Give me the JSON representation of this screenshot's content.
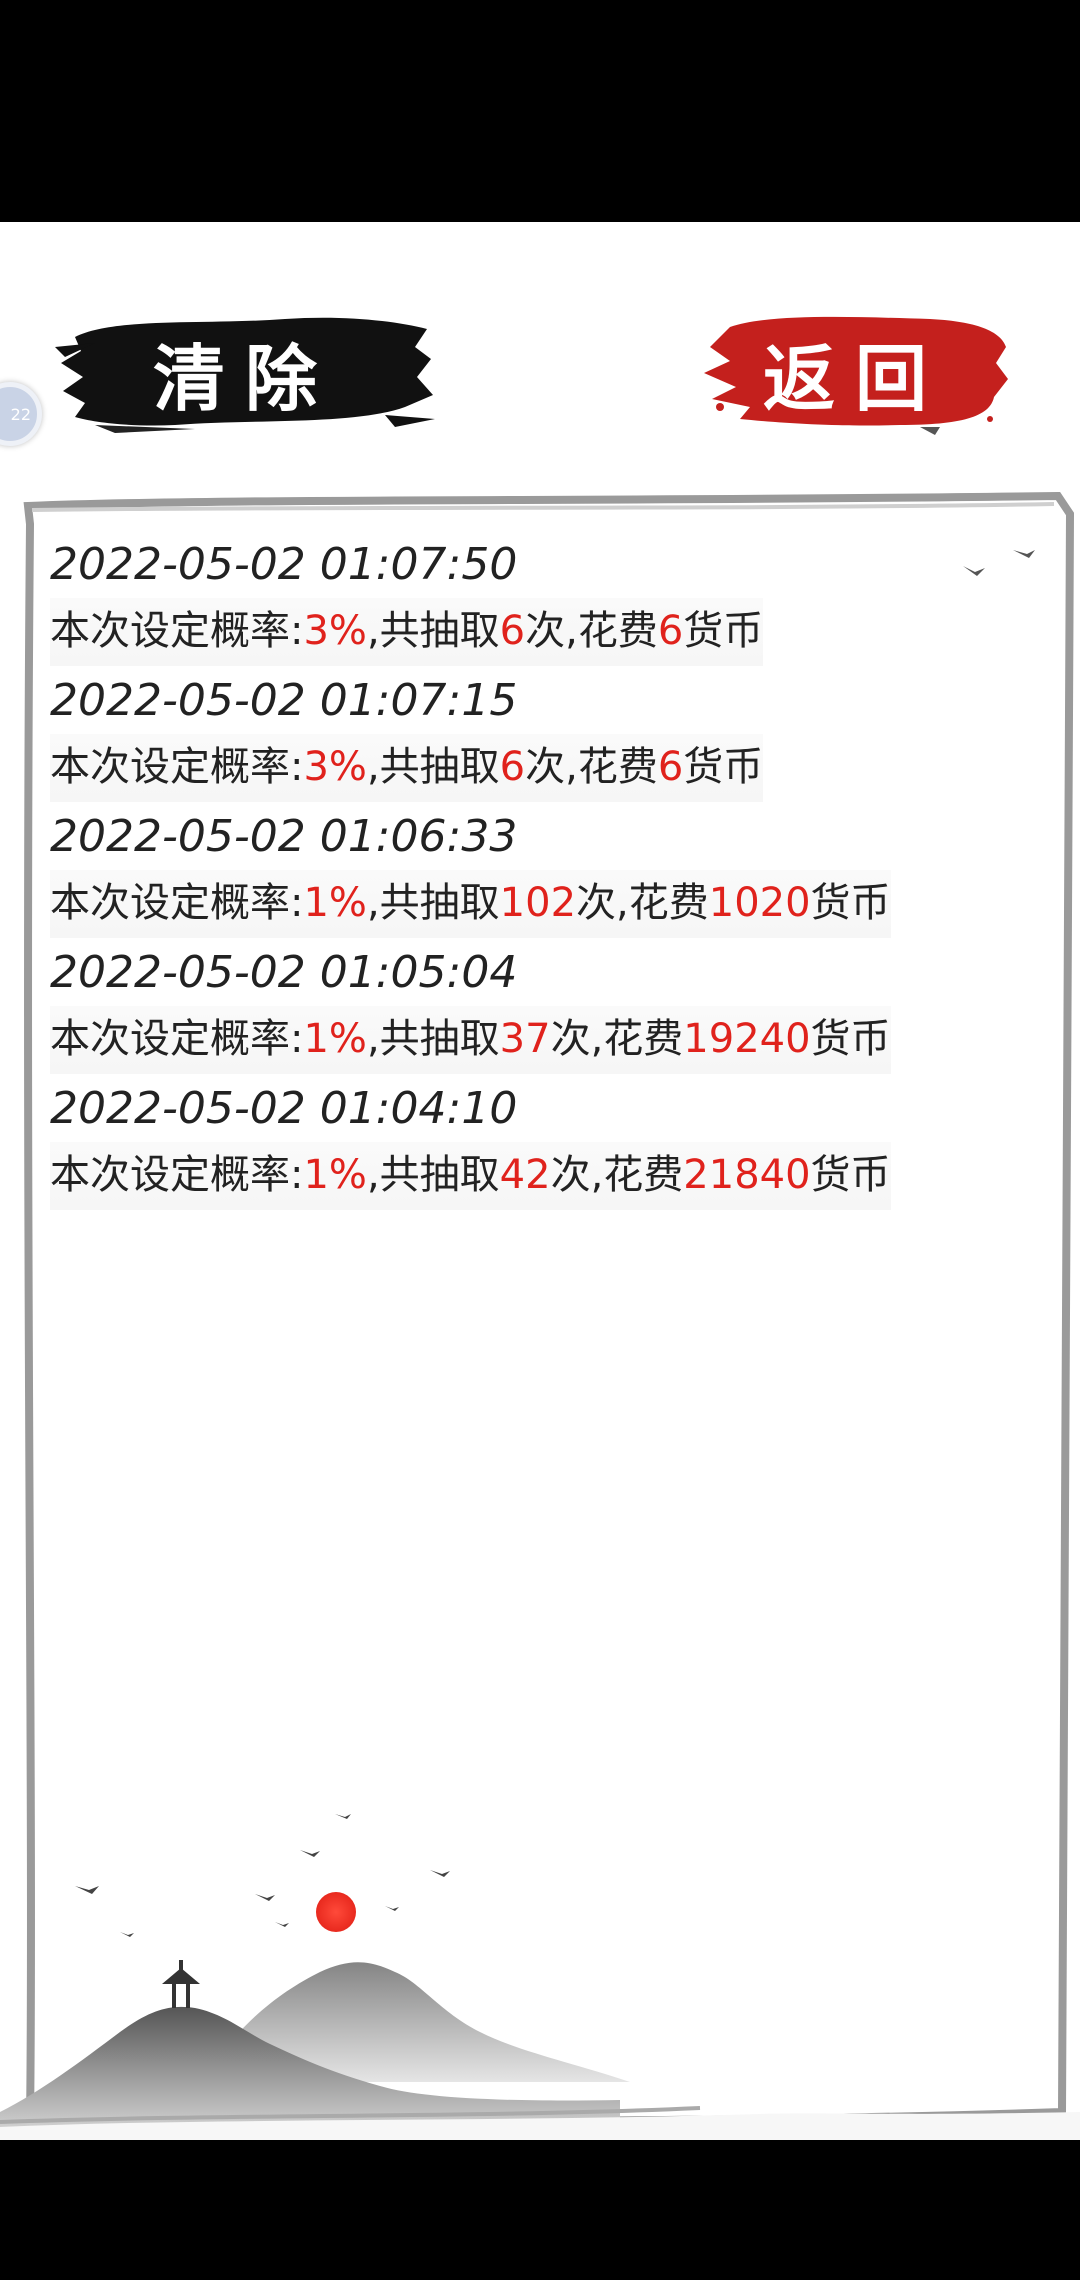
{
  "buttons": {
    "clear_label": "清除",
    "back_label": "返回"
  },
  "float_ball_text": "22",
  "records": [
    {
      "time": "2022-05-02 01:07:50",
      "prefix": "本次设定概率:",
      "rate": "3%",
      "draw_prefix": ",共抽取",
      "draws": "6",
      "cost_prefix": "次,花费",
      "cost": "6",
      "currency": "货币"
    },
    {
      "time": "2022-05-02 01:07:15",
      "prefix": "本次设定概率:",
      "rate": "3%",
      "draw_prefix": ",共抽取",
      "draws": "6",
      "cost_prefix": "次,花费",
      "cost": "6",
      "currency": "货币"
    },
    {
      "time": "2022-05-02 01:06:33",
      "prefix": "本次设定概率:",
      "rate": "1%",
      "draw_prefix": ",共抽取",
      "draws": "102",
      "cost_prefix": "次,花费",
      "cost": "1020",
      "currency": "货币"
    },
    {
      "time": "2022-05-02 01:05:04",
      "prefix": "本次设定概率:",
      "rate": "1%",
      "draw_prefix": ",共抽取",
      "draws": "37",
      "cost_prefix": "次,花费",
      "cost": "19240",
      "currency": "货币"
    },
    {
      "time": "2022-05-02 01:04:10",
      "prefix": "本次设定概率:",
      "rate": "1%",
      "draw_prefix": ",共抽取",
      "draws": "42",
      "cost_prefix": "次,花费",
      "cost": "21840",
      "currency": "货币"
    }
  ],
  "colors": {
    "accent_red": "#e0221c",
    "ink_black": "#111111",
    "seal_red": "#c4201d"
  }
}
